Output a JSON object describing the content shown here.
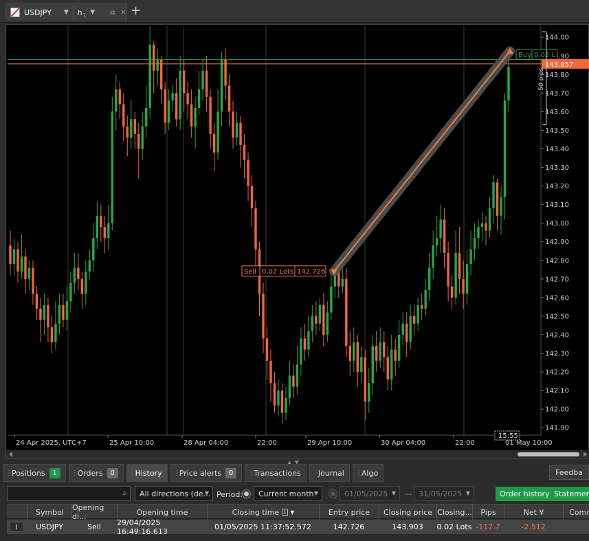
{
  "header": {
    "symbol": "USDJPY",
    "timeframe": "h",
    "timeframe_sub": "1",
    "add_tab_glyph": "+"
  },
  "chart_data": {
    "type": "candlestick",
    "symbol": "USDJPY",
    "timeframe": "h1",
    "ylim": [
      141.86,
      144.06
    ],
    "y_ticks": [
      "144.00",
      "143.90",
      "143.80",
      "143.70",
      "143.60",
      "143.50",
      "143.40",
      "143.30",
      "143.20",
      "143.10",
      "143.00",
      "142.90",
      "142.80",
      "142.70",
      "142.60",
      "142.50",
      "142.40",
      "142.30",
      "142.20",
      "142.10",
      "142.00",
      "141.90"
    ],
    "x_labels": [
      "24 Apr 2025, UTC+7",
      "25 Apr 10:00",
      "28 Apr 04:00",
      "22:00",
      "29 Apr 10:00",
      "30 Apr 04:00",
      "22:00",
      "01 May 10:00"
    ],
    "current_price": "143.857",
    "current_time": "15:55",
    "range_label": "50 pips",
    "trade": {
      "sell_label": "Sell",
      "sell_lots": "0.02 Lots",
      "sell_price_label": "142.726",
      "sell_price": 142.726,
      "buy_label": "Buy",
      "buy_lots": "0.02 L",
      "buy_price": 143.903
    },
    "colors": {
      "bull": "#27a745",
      "bear": "#f0673a",
      "grid": "#3a3a3a",
      "price_line": "#f07a3a",
      "green_line": "#2ea04f"
    },
    "candles": [
      [
        142.88,
        142.78,
        142.96,
        142.72
      ],
      [
        142.78,
        142.86,
        142.92,
        142.72
      ],
      [
        142.86,
        142.74,
        142.9,
        142.68
      ],
      [
        142.74,
        142.82,
        142.94,
        142.7
      ],
      [
        142.82,
        142.7,
        142.86,
        142.62
      ],
      [
        142.7,
        142.76,
        142.8,
        142.64
      ],
      [
        142.76,
        142.62,
        142.8,
        142.56
      ],
      [
        142.62,
        142.54,
        142.66,
        142.48
      ],
      [
        142.54,
        142.48,
        142.6,
        142.36
      ],
      [
        142.48,
        142.56,
        142.62,
        142.4
      ],
      [
        142.56,
        142.44,
        142.6,
        142.36
      ],
      [
        142.44,
        142.36,
        142.5,
        142.3
      ],
      [
        142.36,
        142.46,
        142.58,
        142.32
      ],
      [
        142.46,
        142.56,
        142.62,
        142.4
      ],
      [
        142.56,
        142.48,
        142.62,
        142.44
      ],
      [
        142.48,
        142.58,
        142.66,
        142.42
      ],
      [
        142.58,
        142.68,
        142.74,
        142.52
      ],
      [
        142.68,
        142.76,
        142.84,
        142.62
      ],
      [
        142.76,
        142.7,
        142.84,
        142.64
      ],
      [
        142.7,
        142.62,
        142.74,
        142.54
      ],
      [
        142.62,
        142.74,
        142.8,
        142.56
      ],
      [
        142.74,
        142.8,
        142.86,
        142.7
      ],
      [
        142.8,
        142.92,
        143.0,
        142.74
      ],
      [
        142.92,
        143.04,
        143.12,
        142.86
      ],
      [
        143.04,
        142.98,
        143.1,
        142.9
      ],
      [
        142.98,
        142.92,
        143.04,
        142.84
      ],
      [
        142.92,
        143.0,
        143.1,
        142.86
      ],
      [
        143.0,
        143.6,
        143.68,
        142.96
      ],
      [
        143.6,
        143.72,
        143.8,
        143.5
      ],
      [
        143.72,
        143.64,
        143.76,
        143.56
      ],
      [
        143.64,
        143.52,
        143.7,
        143.44
      ],
      [
        143.52,
        143.46,
        143.58,
        143.36
      ],
      [
        143.46,
        143.56,
        143.66,
        143.4
      ],
      [
        143.56,
        143.48,
        143.6,
        143.4
      ],
      [
        143.48,
        143.4,
        143.54,
        143.24
      ],
      [
        143.4,
        143.52,
        143.6,
        143.34
      ],
      [
        143.52,
        143.62,
        143.74,
        143.46
      ],
      [
        143.62,
        143.96,
        144.06,
        143.56
      ],
      [
        143.96,
        143.82,
        143.98,
        143.7
      ],
      [
        143.82,
        143.88,
        143.94,
        143.74
      ],
      [
        143.88,
        143.72,
        143.9,
        143.64
      ],
      [
        143.72,
        143.54,
        143.76,
        143.48
      ],
      [
        143.54,
        143.66,
        143.72,
        143.5
      ],
      [
        143.66,
        143.7,
        143.74,
        143.6
      ],
      [
        143.7,
        143.56,
        143.78,
        143.52
      ],
      [
        143.56,
        143.82,
        143.9,
        143.5
      ],
      [
        143.82,
        143.7,
        143.88,
        143.6
      ],
      [
        143.7,
        143.64,
        143.76,
        143.56
      ],
      [
        143.64,
        143.52,
        143.72,
        143.46
      ],
      [
        143.52,
        143.62,
        143.68,
        143.4
      ],
      [
        143.62,
        143.72,
        143.82,
        143.58
      ],
      [
        143.72,
        143.82,
        143.88,
        143.66
      ],
      [
        143.82,
        143.68,
        143.9,
        143.6
      ],
      [
        143.68,
        143.48,
        143.72,
        143.4
      ],
      [
        143.48,
        143.38,
        143.54,
        143.28
      ],
      [
        143.38,
        143.6,
        143.72,
        143.34
      ],
      [
        143.6,
        143.88,
        143.92,
        143.52
      ],
      [
        143.88,
        143.74,
        143.94,
        143.66
      ],
      [
        143.74,
        143.6,
        143.8,
        143.52
      ],
      [
        143.6,
        143.46,
        143.66,
        143.4
      ],
      [
        143.46,
        143.54,
        143.6,
        143.42
      ],
      [
        143.54,
        143.42,
        143.58,
        143.3
      ],
      [
        143.42,
        143.34,
        143.48,
        143.24
      ],
      [
        143.34,
        143.2,
        143.38,
        143.12
      ],
      [
        143.2,
        143.08,
        143.26,
        142.98
      ],
      [
        143.08,
        142.86,
        143.12,
        142.76
      ],
      [
        142.86,
        142.62,
        142.9,
        142.5
      ],
      [
        142.62,
        142.38,
        142.68,
        142.3
      ],
      [
        142.38,
        142.26,
        142.44,
        142.16
      ],
      [
        142.26,
        142.14,
        142.32,
        142.04
      ],
      [
        142.14,
        142.02,
        142.2,
        141.98
      ],
      [
        142.02,
        142.1,
        142.16,
        141.96
      ],
      [
        142.1,
        141.98,
        142.14,
        141.92
      ],
      [
        141.98,
        142.06,
        142.12,
        141.94
      ],
      [
        142.06,
        142.18,
        142.26,
        142.02
      ],
      [
        142.18,
        142.12,
        142.24,
        142.06
      ],
      [
        142.12,
        142.24,
        142.34,
        142.08
      ],
      [
        142.24,
        142.38,
        142.44,
        142.18
      ],
      [
        142.38,
        142.32,
        142.46,
        142.26
      ],
      [
        142.32,
        142.42,
        142.5,
        142.28
      ],
      [
        142.42,
        142.5,
        142.56,
        142.36
      ],
      [
        142.5,
        142.46,
        142.58,
        142.4
      ],
      [
        142.46,
        142.56,
        142.6,
        142.42
      ],
      [
        142.56,
        142.4,
        142.62,
        142.34
      ],
      [
        142.4,
        142.52,
        142.58,
        142.36
      ],
      [
        142.52,
        142.66,
        142.72,
        142.48
      ],
      [
        142.66,
        142.74,
        142.78,
        142.6
      ],
      [
        142.74,
        142.66,
        142.78,
        142.6
      ],
      [
        142.66,
        142.7,
        142.76,
        142.62
      ],
      [
        142.7,
        142.34,
        142.76,
        142.28
      ],
      [
        142.34,
        142.26,
        142.42,
        142.18
      ],
      [
        142.26,
        142.36,
        142.44,
        142.2
      ],
      [
        142.36,
        142.2,
        142.4,
        142.12
      ],
      [
        142.2,
        142.28,
        142.34,
        142.14
      ],
      [
        142.28,
        142.04,
        142.32,
        141.94
      ],
      [
        142.04,
        142.14,
        142.22,
        141.98
      ],
      [
        142.14,
        142.34,
        142.4,
        142.08
      ],
      [
        142.34,
        142.26,
        142.42,
        142.2
      ],
      [
        142.26,
        142.36,
        142.44,
        142.22
      ],
      [
        142.36,
        142.28,
        142.42,
        142.2
      ],
      [
        142.28,
        142.16,
        142.34,
        142.1
      ],
      [
        142.16,
        142.32,
        142.4,
        142.1
      ],
      [
        142.32,
        142.26,
        142.38,
        142.18
      ],
      [
        142.26,
        142.4,
        142.48,
        142.22
      ],
      [
        142.4,
        142.46,
        142.52,
        142.34
      ],
      [
        142.46,
        142.36,
        142.52,
        142.28
      ],
      [
        142.36,
        142.5,
        142.56,
        142.32
      ],
      [
        142.5,
        142.46,
        142.56,
        142.4
      ],
      [
        142.46,
        142.56,
        142.6,
        142.42
      ],
      [
        142.56,
        142.54,
        142.62,
        142.48
      ],
      [
        142.54,
        142.64,
        142.7,
        142.5
      ],
      [
        142.64,
        142.76,
        142.84,
        142.58
      ],
      [
        142.76,
        142.88,
        142.96,
        142.7
      ],
      [
        142.88,
        142.92,
        143.04,
        142.82
      ],
      [
        142.92,
        143.02,
        143.1,
        142.84
      ],
      [
        143.02,
        142.84,
        143.08,
        142.76
      ],
      [
        142.84,
        142.66,
        142.9,
        142.58
      ],
      [
        142.66,
        142.6,
        142.72,
        142.54
      ],
      [
        142.6,
        142.84,
        142.96,
        142.56
      ],
      [
        142.84,
        142.7,
        142.98,
        142.62
      ],
      [
        142.7,
        142.62,
        142.8,
        142.54
      ],
      [
        142.62,
        142.78,
        142.86,
        142.56
      ],
      [
        142.78,
        142.86,
        142.96,
        142.72
      ],
      [
        142.86,
        142.92,
        143.0,
        142.8
      ],
      [
        142.92,
        142.98,
        143.02,
        142.86
      ],
      [
        142.98,
        143.0,
        143.06,
        142.9
      ],
      [
        143.0,
        142.96,
        143.04,
        142.88
      ],
      [
        142.96,
        143.08,
        143.14,
        142.92
      ],
      [
        143.08,
        143.22,
        143.26,
        143.0
      ],
      [
        143.22,
        143.04,
        143.24,
        142.96
      ],
      [
        143.04,
        143.14,
        143.2,
        142.94
      ],
      [
        143.14,
        143.66,
        143.7,
        143.02
      ],
      [
        143.66,
        143.84,
        143.92,
        143.6
      ]
    ]
  },
  "bottom_tabs": [
    {
      "label": "Positions",
      "badge": "1"
    },
    {
      "label": "Orders",
      "badge": "0"
    },
    {
      "label": "History"
    },
    {
      "label": "Price alerts",
      "badge": "0"
    },
    {
      "label": "Transactions"
    },
    {
      "label": "Journal"
    },
    {
      "label": "Algo"
    }
  ],
  "feedback_label": "Feedba",
  "filters": {
    "search_value": "",
    "direction": "All directions (de...",
    "period_label": "Period:",
    "period": "Current month",
    "date_from": "01/05/2025",
    "date_to": "31/05/2025",
    "order_history_label": "Order history",
    "statement_label": "Statement",
    "range_dash": "—"
  },
  "table": {
    "headers": [
      "Symbol",
      "Opening di...",
      "Opening time",
      "Closing time",
      "Entry price",
      "Closing price",
      "Closing...",
      "Pips",
      "Net ¥",
      "Comme"
    ],
    "sort_index": "1",
    "sort_arrow": "▼",
    "info_glyph": "i",
    "rows": [
      {
        "symbol": "USDJPY",
        "direction": "Sell",
        "opening_time": "29/04/2025 16:49:16.613",
        "closing_time": "01/05/2025 11:37:52.572",
        "entry_price": "142.726",
        "closing_price": "143.903",
        "closing_qty": "0.02 Lots",
        "pips": "-117.7",
        "net": "-2.512",
        "comment": ""
      }
    ]
  }
}
